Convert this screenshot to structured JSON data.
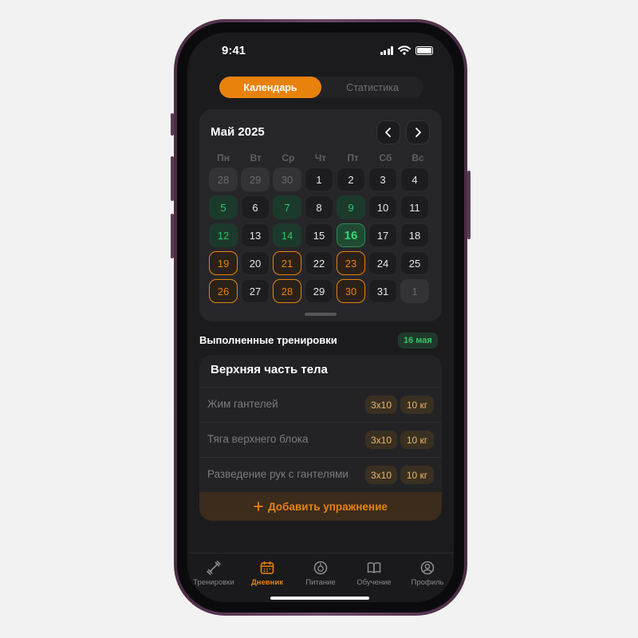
{
  "status": {
    "time": "9:41"
  },
  "segmented": {
    "tabs": [
      {
        "label": "Календарь",
        "active": true
      },
      {
        "label": "Статистика",
        "active": false
      }
    ]
  },
  "calendar": {
    "title": "Май 2025",
    "weekdays": [
      "Пн",
      "Вт",
      "Ср",
      "Чт",
      "Пт",
      "Сб",
      "Вс"
    ],
    "days": [
      {
        "n": "28",
        "s": "muted"
      },
      {
        "n": "29",
        "s": "muted"
      },
      {
        "n": "30",
        "s": "muted"
      },
      {
        "n": "1",
        "s": ""
      },
      {
        "n": "2",
        "s": ""
      },
      {
        "n": "3",
        "s": ""
      },
      {
        "n": "4",
        "s": ""
      },
      {
        "n": "5",
        "s": "done"
      },
      {
        "n": "6",
        "s": ""
      },
      {
        "n": "7",
        "s": "done"
      },
      {
        "n": "8",
        "s": ""
      },
      {
        "n": "9",
        "s": "done"
      },
      {
        "n": "10",
        "s": ""
      },
      {
        "n": "11",
        "s": ""
      },
      {
        "n": "12",
        "s": "done"
      },
      {
        "n": "13",
        "s": ""
      },
      {
        "n": "14",
        "s": "done"
      },
      {
        "n": "15",
        "s": ""
      },
      {
        "n": "16",
        "s": "today"
      },
      {
        "n": "17",
        "s": ""
      },
      {
        "n": "18",
        "s": ""
      },
      {
        "n": "19",
        "s": "planned"
      },
      {
        "n": "20",
        "s": ""
      },
      {
        "n": "21",
        "s": "planned"
      },
      {
        "n": "22",
        "s": ""
      },
      {
        "n": "23",
        "s": "planned"
      },
      {
        "n": "24",
        "s": ""
      },
      {
        "n": "25",
        "s": ""
      },
      {
        "n": "26",
        "s": "planned"
      },
      {
        "n": "27",
        "s": ""
      },
      {
        "n": "28",
        "s": "planned"
      },
      {
        "n": "29",
        "s": ""
      },
      {
        "n": "30",
        "s": "planned"
      },
      {
        "n": "31",
        "s": ""
      },
      {
        "n": "1",
        "s": "muted"
      }
    ]
  },
  "completed": {
    "title": "Выполненные тренировки",
    "date_badge": "16 мая",
    "workout": {
      "title": "Верхняя часть тела",
      "exercises": [
        {
          "name": "Жим гантелей",
          "sets": "3x10",
          "weight": "10 кг"
        },
        {
          "name": "Тяга верхнего блока",
          "sets": "3x10",
          "weight": "10 кг"
        },
        {
          "name": "Разведение рук с гантелями",
          "sets": "3x10",
          "weight": "10 кг"
        }
      ],
      "add_label": "Добавить упражнение"
    }
  },
  "tabbar": {
    "items": [
      {
        "label": "Тренировки",
        "icon": "dumbbell-icon",
        "active": false
      },
      {
        "label": "Дневник",
        "icon": "calendar-icon",
        "active": true
      },
      {
        "label": "Питание",
        "icon": "nutrition-icon",
        "active": false
      },
      {
        "label": "Обучение",
        "icon": "book-icon",
        "active": false
      },
      {
        "label": "Профиль",
        "icon": "profile-icon",
        "active": false
      }
    ]
  },
  "colors": {
    "accent": "#e8820c",
    "success": "#34c36b",
    "background": "#1b1b1e"
  }
}
